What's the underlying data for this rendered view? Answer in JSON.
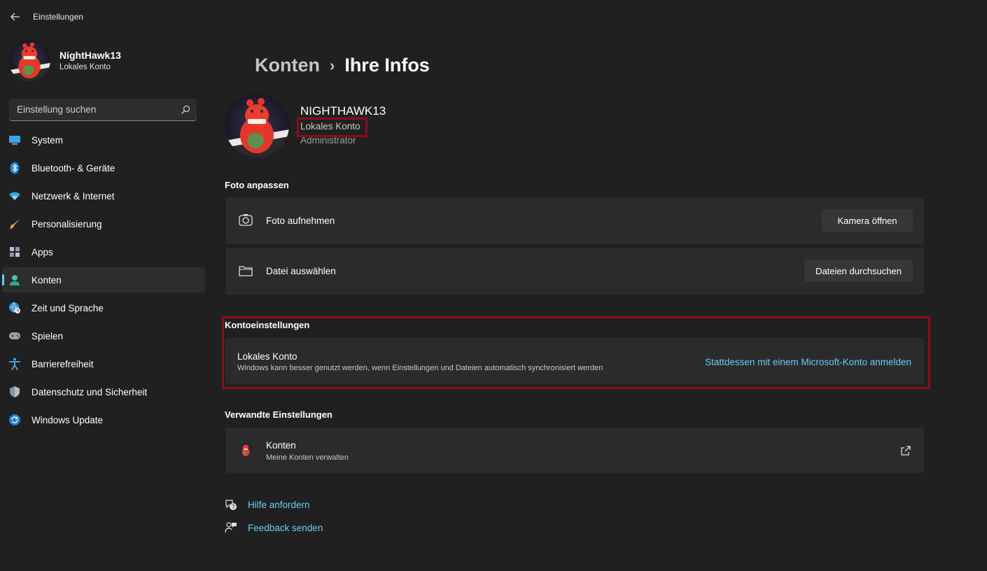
{
  "window": {
    "title": "Einstellungen"
  },
  "profile": {
    "name": "NightHawk13",
    "type": "Lokales Konto"
  },
  "search": {
    "placeholder": "Einstellung suchen"
  },
  "sidebar": {
    "items": [
      {
        "label": "System",
        "icon": "monitor-icon"
      },
      {
        "label": "Bluetooth- & Geräte",
        "icon": "bluetooth-icon"
      },
      {
        "label": "Netzwerk & Internet",
        "icon": "wifi-icon"
      },
      {
        "label": "Personalisierung",
        "icon": "brush-icon"
      },
      {
        "label": "Apps",
        "icon": "apps-icon"
      },
      {
        "label": "Konten",
        "icon": "person-icon",
        "active": true
      },
      {
        "label": "Zeit und Sprache",
        "icon": "globe-clock-icon"
      },
      {
        "label": "Spielen",
        "icon": "gamepad-icon"
      },
      {
        "label": "Barrierefreiheit",
        "icon": "accessibility-icon"
      },
      {
        "label": "Datenschutz und Sicherheit",
        "icon": "shield-icon"
      },
      {
        "label": "Windows Update",
        "icon": "update-icon"
      }
    ]
  },
  "breadcrumb": {
    "parent": "Konten",
    "separator": "›",
    "current": "Ihre Infos"
  },
  "user": {
    "name": "NIGHTHAWK13",
    "account_type": "Lokales Konto",
    "role": "Administrator"
  },
  "photo_section": {
    "title": "Foto anpassen",
    "take_photo": {
      "label": "Foto aufnehmen",
      "button": "Kamera öffnen"
    },
    "choose_file": {
      "label": "Datei auswählen",
      "button": "Dateien durchsuchen"
    }
  },
  "account_section": {
    "title": "Kontoeinstellungen",
    "card_title": "Lokales Konto",
    "card_desc": "Windows kann besser genutzt werden, wenn Einstellungen und Dateien automatisch synchronisiert werden",
    "link": "Stattdessen mit einem Microsoft-Konto anmelden"
  },
  "related_section": {
    "title": "Verwandte Einstellungen",
    "konten_title": "Konten",
    "konten_sub": "Meine Konten verwalten"
  },
  "help": {
    "get_help": "Hilfe anfordern",
    "feedback": "Feedback senden"
  },
  "colors": {
    "accent": "#60cdff",
    "link": "#6ccbf2",
    "highlight": "#8b0c1e",
    "background": "#202020",
    "card": "#2b2b2b"
  }
}
